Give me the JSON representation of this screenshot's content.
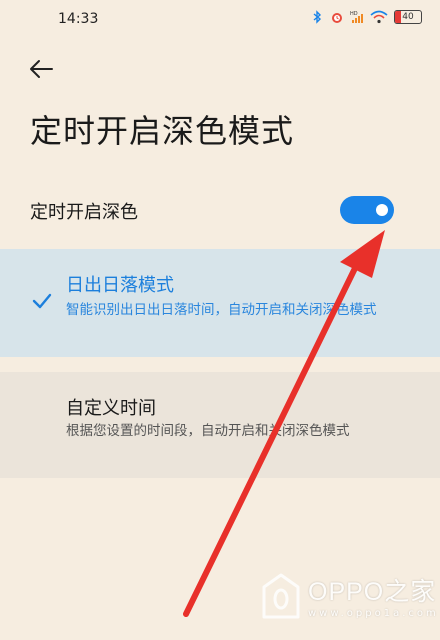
{
  "status_bar": {
    "time": "14:33",
    "battery": "40",
    "icons": [
      "bluetooth-icon",
      "alarm-icon",
      "hd-signal-icon",
      "wifi-icon",
      "battery-icon"
    ]
  },
  "header": {
    "back_icon": "back-arrow-icon",
    "title": "定时开启深色模式"
  },
  "schedule_toggle": {
    "label": "定时开启深色",
    "on": true,
    "color": "#1a84e8"
  },
  "options": [
    {
      "title": "日出日落模式",
      "description": "智能识别出日出日落时间，自动开启和关闭深色模式",
      "selected": true,
      "accent": "#1c7fdc"
    },
    {
      "title": "自定义时间",
      "description": "根据您设置的时间段，自动开启和关闭深色模式",
      "selected": false
    }
  ],
  "annotation": {
    "type": "red-arrow",
    "color": "#e8302a",
    "points_to": "schedule-toggle-switch"
  },
  "watermark": {
    "brand": "OPPO之家",
    "url": "www.oppo1a.com"
  }
}
